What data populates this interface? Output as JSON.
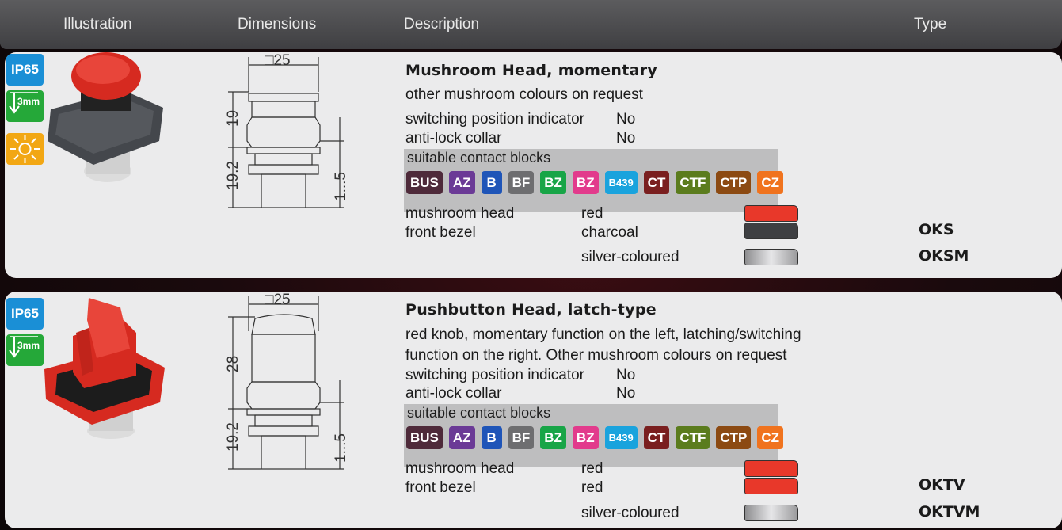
{
  "header": {
    "illustration": "Illustration",
    "dimensions": "Dimensions",
    "description": "Description",
    "type": "Type"
  },
  "products": [
    {
      "badges": {
        "ip": "IP65",
        "travel": "3mm"
      },
      "dims": {
        "width": "□25",
        "upper": "19",
        "lower": "19.2",
        "range": "1...5"
      },
      "title": "Mushroom Head, momentary",
      "desc_lines": [
        "other mushroom colours on request"
      ],
      "indicator_label": "switching position indicator",
      "indicator_value": "No",
      "collar_label": "anti-lock collar",
      "collar_value": "No",
      "blocks_label": "suitable contact blocks",
      "blocks": [
        "BUS",
        "AZ",
        "B",
        "BF",
        "BZ",
        "BZ",
        "B439",
        "CT",
        "CTF",
        "CTP",
        "CZ"
      ],
      "specs": [
        {
          "label": "mushroom head",
          "value": "red",
          "color": "#e8382a",
          "type": ""
        },
        {
          "label": "front bezel",
          "value": "charcoal",
          "color": "#3e3f42",
          "type": "OKS"
        },
        {
          "label": "",
          "value": "silver-coloured",
          "color": "#b4b4b6",
          "type": "OKSM"
        }
      ]
    },
    {
      "badges": {
        "ip": "IP65",
        "travel": "3mm"
      },
      "dims": {
        "width": "□25",
        "upper": "28",
        "lower": "19.2",
        "range": "1...5"
      },
      "title": "Pushbutton Head, latch-type",
      "desc_lines": [
        "red knob, momentary function on the left, latching/switching",
        "function on the right. Other mushroom colours on request"
      ],
      "indicator_label": "switching position indicator",
      "indicator_value": "No",
      "collar_label": "anti-lock collar",
      "collar_value": "No",
      "blocks_label": "suitable contact blocks",
      "blocks": [
        "BUS",
        "AZ",
        "B",
        "BF",
        "BZ",
        "BZ",
        "B439",
        "CT",
        "CTF",
        "CTP",
        "CZ"
      ],
      "specs": [
        {
          "label": "mushroom head",
          "value": "red",
          "color": "#e8382a",
          "type": ""
        },
        {
          "label": "front bezel",
          "value": "red",
          "color": "#e8382a",
          "type": "OKTV"
        },
        {
          "label": "",
          "value": "silver-coloured",
          "color": "#b4b4b6",
          "type": "OKTVM"
        }
      ]
    }
  ],
  "block_colors": {
    "BUS": "#4e2a3a",
    "AZ": "#6b3a96",
    "B": "#1f55b8",
    "BF": "#6e6e70",
    "BZ_1": "#18a547",
    "BZ_2": "#e23b8c",
    "B439": "#1aa3dd",
    "CT": "#7a1f1f",
    "CTF": "#5b7c1d",
    "CTP": "#8c4a12",
    "CZ": "#f0731e"
  }
}
